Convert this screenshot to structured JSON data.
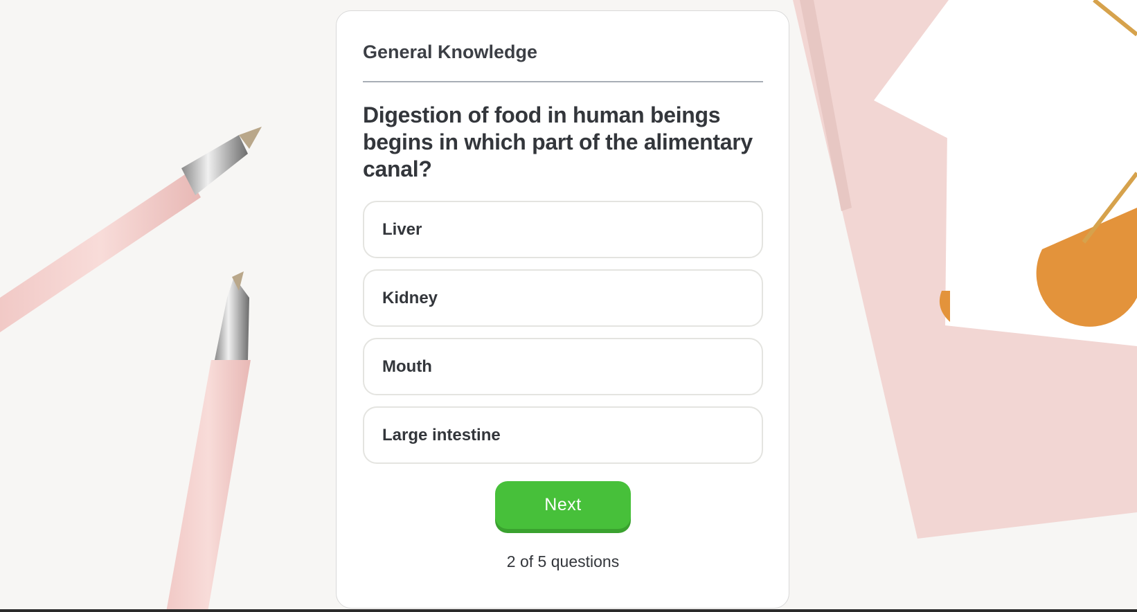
{
  "quiz": {
    "category": "General Knowledge",
    "question": "Digestion of food in human beings begins in which part of the alimentary canal?",
    "options": [
      {
        "label": "Liver"
      },
      {
        "label": "Kidney"
      },
      {
        "label": "Mouth"
      },
      {
        "label": "Large intestine"
      }
    ],
    "next_label": "Next",
    "progress_text": "2 of 5 questions"
  },
  "colors": {
    "next_button": "#47c03a",
    "text": "#33363b",
    "divider": "#a8aeb5"
  },
  "background": {
    "icons": [
      "pink-pen-icon",
      "pink-pen-icon",
      "notebook-icon"
    ]
  }
}
